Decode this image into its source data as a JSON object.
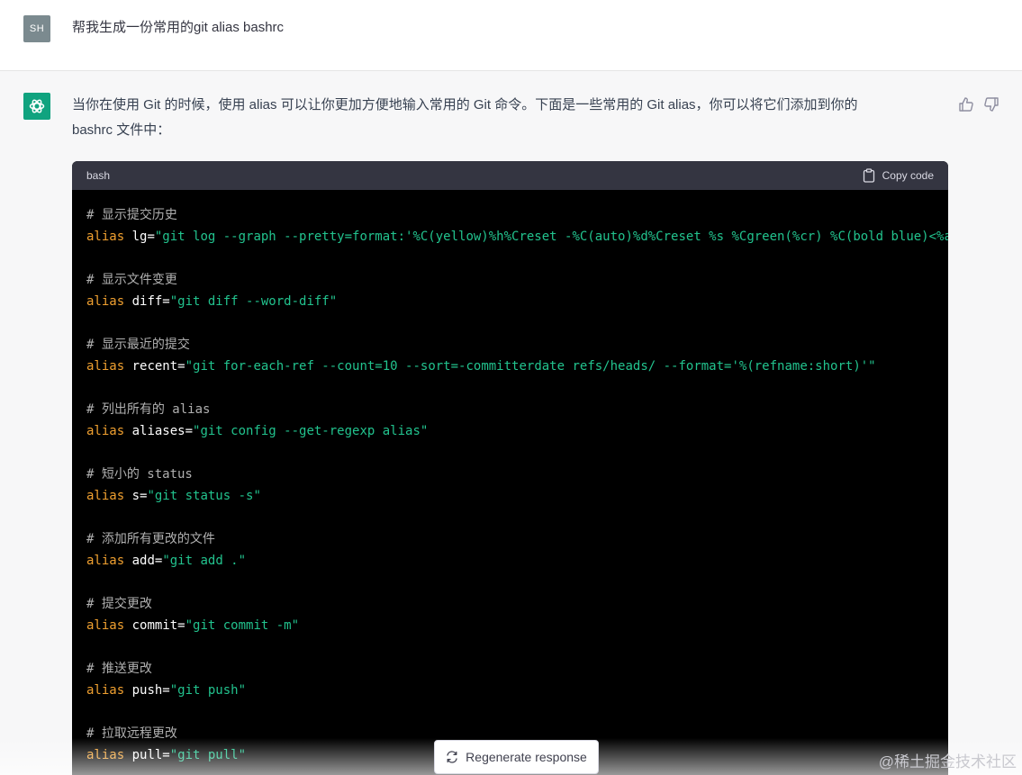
{
  "user": {
    "avatar_initials": "SH",
    "message": "帮我生成一份常用的git alias bashrc"
  },
  "assistant": {
    "intro_line1": "当你在使用 Git 的时候，使用 alias 可以让你更加方便地输入常用的 Git 命令。下面是一些常用的 Git alias，你可以将它们添加到你的",
    "intro_line2": "bashrc 文件中：",
    "code": {
      "language": "bash",
      "copy_label": "Copy code",
      "lines": [
        {
          "comment": "# 显示提交历史"
        },
        {
          "kw": "alias",
          "name": " lg=",
          "str": "\"git log --graph --pretty=format:'%C(yellow)%h%Creset -%C(auto)%d%Creset %s %Cgreen(%cr) %C(bold blue)<%an>"
        },
        {
          "blank": true
        },
        {
          "comment": "# 显示文件变更"
        },
        {
          "kw": "alias",
          "name": " diff=",
          "str": "\"git diff --word-diff\""
        },
        {
          "blank": true
        },
        {
          "comment": "# 显示最近的提交"
        },
        {
          "kw": "alias",
          "name": " recent=",
          "str": "\"git for-each-ref --count=10 --sort=-committerdate refs/heads/ --format='%(refname:short)'\""
        },
        {
          "blank": true
        },
        {
          "comment": "# 列出所有的 alias"
        },
        {
          "kw": "alias",
          "name": " aliases=",
          "str": "\"git config --get-regexp alias\""
        },
        {
          "blank": true
        },
        {
          "comment": "# 短小的 status"
        },
        {
          "kw": "alias",
          "name": " s=",
          "str": "\"git status -s\""
        },
        {
          "blank": true
        },
        {
          "comment": "# 添加所有更改的文件"
        },
        {
          "kw": "alias",
          "name": " add=",
          "str": "\"git add .\""
        },
        {
          "blank": true
        },
        {
          "comment": "# 提交更改"
        },
        {
          "kw": "alias",
          "name": " commit=",
          "str": "\"git commit -m\""
        },
        {
          "blank": true
        },
        {
          "comment": "# 推送更改"
        },
        {
          "kw": "alias",
          "name": " push=",
          "str": "\"git push\""
        },
        {
          "blank": true
        },
        {
          "comment": "# 拉取远程更改"
        },
        {
          "kw": "alias",
          "name": " pull=",
          "str": "\"git pull\""
        }
      ]
    }
  },
  "regenerate_label": "Regenerate response",
  "watermark": "@稀土掘金技术社区",
  "colors": {
    "accent": "#10a37f",
    "code_bg": "#000000",
    "code_header_bg": "#343541",
    "keyword": "#f0a030",
    "string": "#22c38e",
    "comment": "#b0b0b0"
  },
  "icons": {
    "bot_avatar": "openai-logo-icon",
    "thumb_up": "thumb-up-icon",
    "thumb_down": "thumb-down-icon",
    "copy": "clipboard-icon",
    "regenerate": "refresh-icon"
  }
}
